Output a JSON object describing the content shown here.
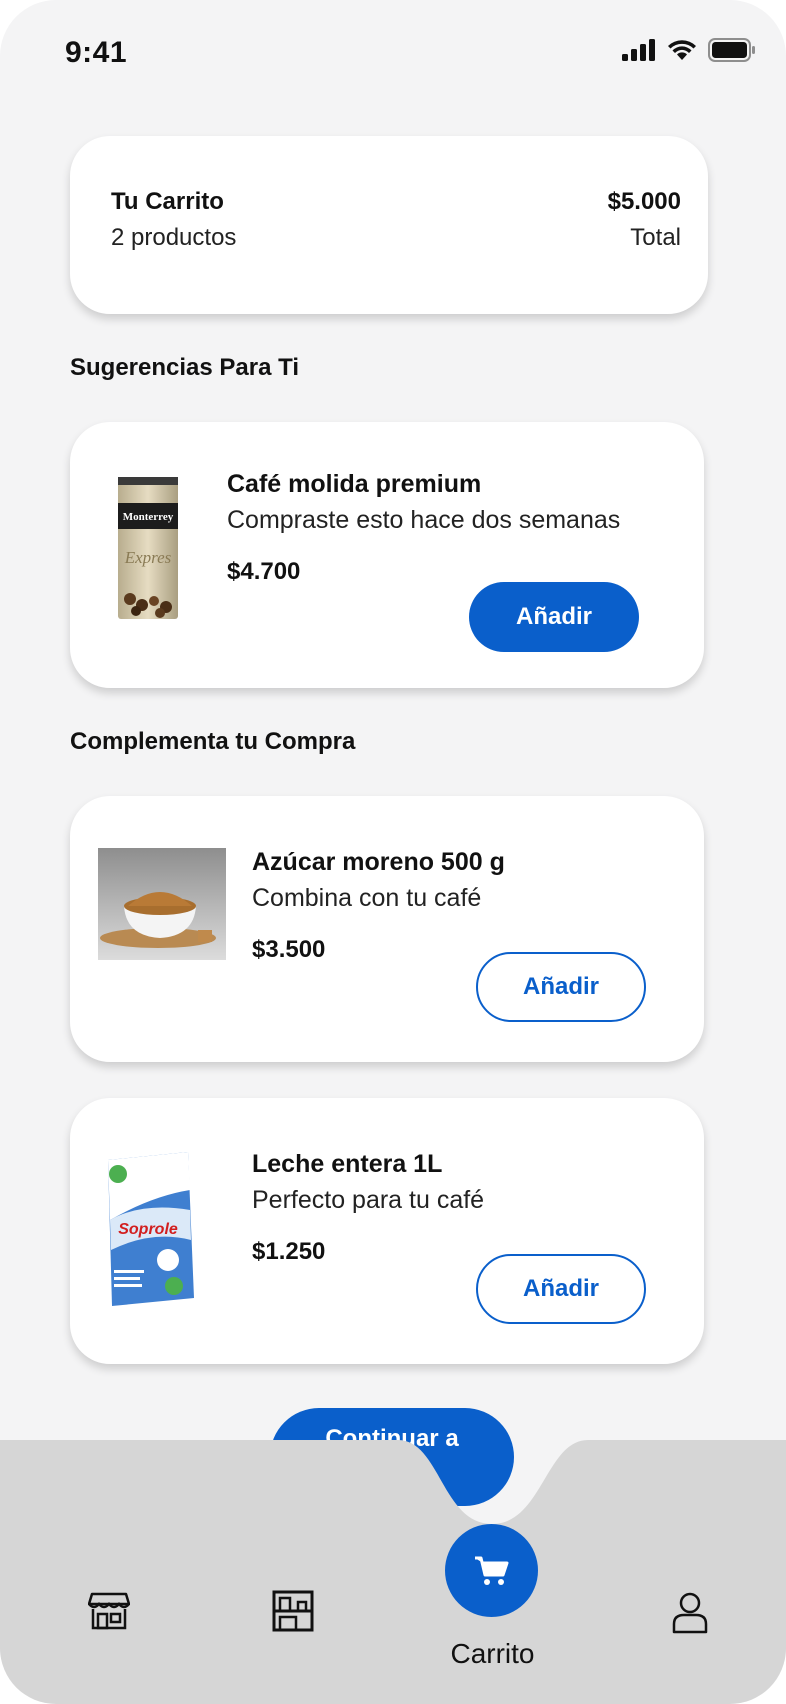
{
  "status_bar": {
    "time": "9:41"
  },
  "summary": {
    "title": "Tu Carrito",
    "count": "2 productos",
    "total": "$5.000",
    "total_label": "Total"
  },
  "sections": {
    "suggestions": "Sugerencias Para Ti",
    "complement": "Complementa tu Compra"
  },
  "suggestions": [
    {
      "name": "Café molida premium",
      "desc": "Compraste esto hace dos semanas",
      "price": "$4.700",
      "button": "Añadir",
      "image": "coffee-bag"
    }
  ],
  "complements": [
    {
      "name": "Azúcar moreno 500 g",
      "desc": "Combina con tu café",
      "price": "$3.500",
      "button": "Añadir",
      "image": "brown-sugar-bowl"
    },
    {
      "name": "Leche entera 1L",
      "desc": "Perfecto para tu café",
      "price": "$1.250",
      "button": "Añadir",
      "image": "milk-carton"
    }
  ],
  "product_logos": {
    "coffee": "Monterrey",
    "coffee_script": "Expres",
    "milk": "Soprole"
  },
  "checkout": {
    "label": "Continuar a Pagar"
  },
  "nav": {
    "items": [
      {
        "icon": "store-icon"
      },
      {
        "icon": "shelves-icon"
      },
      {
        "icon": "cart-icon",
        "label": "Carrito",
        "active": true
      },
      {
        "icon": "user-icon"
      }
    ]
  },
  "colors": {
    "accent": "#0a5fcb",
    "background": "#f4f4f5",
    "navbar": "#d6d6d6"
  }
}
